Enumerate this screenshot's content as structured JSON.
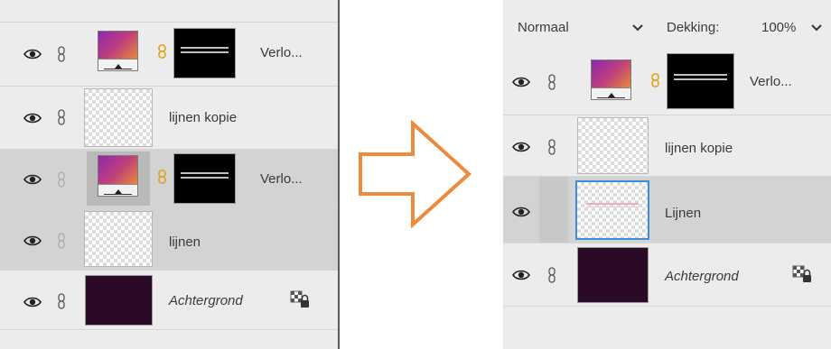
{
  "left_panel": {
    "layers": [
      {
        "label": "Verlo...",
        "type": "gradient-masked",
        "selected": false,
        "chain_visible": true
      },
      {
        "label": "lijnen kopie",
        "type": "transparent",
        "selected": false,
        "chain_visible": true
      },
      {
        "label": "Verlo...",
        "type": "gradient-masked",
        "selected": true,
        "chain_visible": false
      },
      {
        "label": "lijnen",
        "type": "transparent",
        "selected": true,
        "chain_visible": false
      },
      {
        "label": "Achtergrond",
        "type": "background",
        "selected": false,
        "chain_visible": true,
        "locked": true
      }
    ]
  },
  "right_panel": {
    "blend_mode": "Normaal",
    "opacity_label": "Dekking:",
    "opacity_value": "100%",
    "layers": [
      {
        "label": "Verlo...",
        "type": "gradient-masked",
        "selected": false
      },
      {
        "label": "lijnen kopie",
        "type": "transparent",
        "selected": false
      },
      {
        "label": "Lijnen",
        "type": "transparent-lines",
        "selected": true
      },
      {
        "label": "Achtergrond",
        "type": "background",
        "selected": false,
        "locked": true
      }
    ]
  },
  "icons": {
    "visibility": "eye-icon",
    "link": "chain-link-icon",
    "mask_link": "mask-link-icon",
    "lock": "lock-icon",
    "arrow": "right-arrow-icon",
    "dropdown": "chevron-down-icon"
  },
  "colors": {
    "panel_bg": "#ececec",
    "selected_row": "#d3d3d3",
    "selected_thumb_border": "#3d8fd6",
    "arrow_stroke": "#ee8a3c",
    "background_layer": "#2a0a26"
  }
}
